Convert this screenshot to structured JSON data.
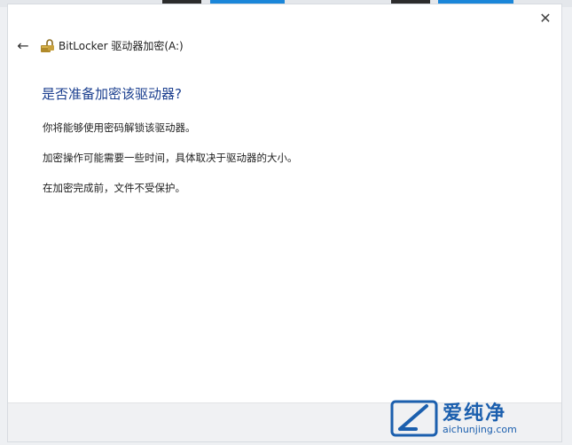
{
  "window": {
    "app_title": "BitLocker 驱动器加密(A:)",
    "close_icon": "close-icon",
    "back_icon": "arrow-left-icon"
  },
  "content": {
    "heading": "是否准备加密该驱动器?",
    "lines": [
      "你将能够使用密码解锁该驱动器。",
      "加密操作可能需要一些时间，具体取决于驱动器的大小。",
      "在加密完成前，文件不受保护。"
    ]
  },
  "watermark": {
    "brand": "爱纯净",
    "url": "aichunjing.com"
  },
  "colors": {
    "heading": "#1b3f8f",
    "accent": "#1a86d9",
    "watermark": "#1b5fae"
  }
}
